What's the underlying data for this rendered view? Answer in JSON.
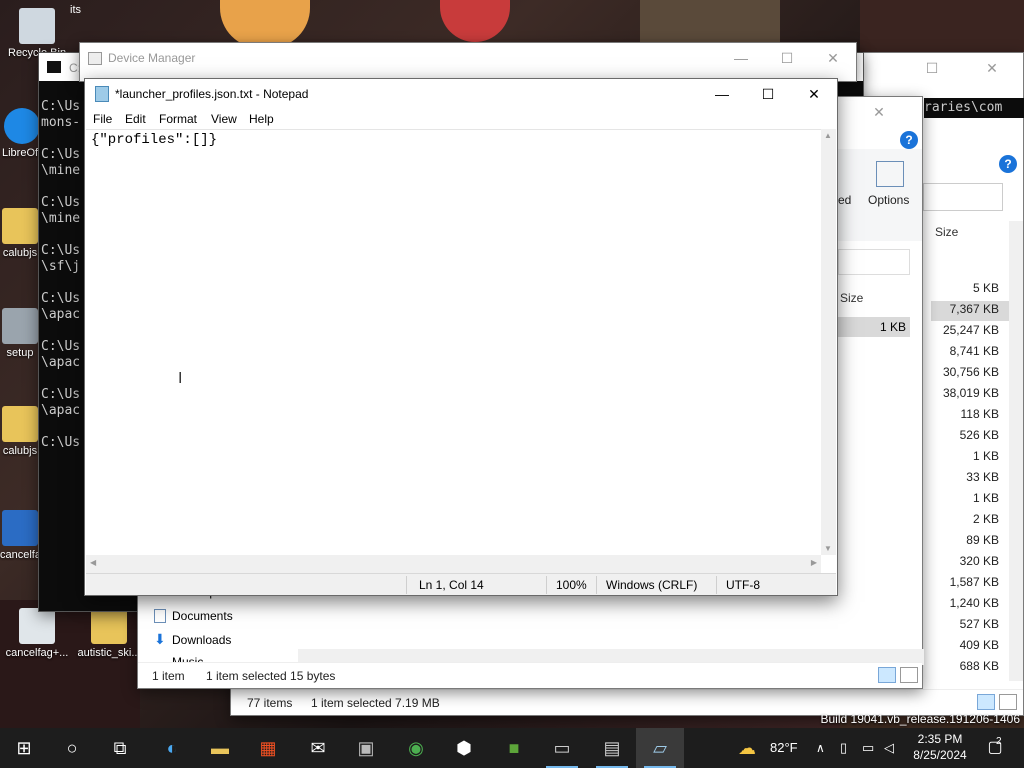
{
  "desktop": {
    "top_label": "its",
    "watermark": "Build 19041.vb_release.191206-1406",
    "icons": [
      {
        "label": "Recycle Bin"
      },
      {
        "label": "LibreOffice"
      },
      {
        "label": "calubjs"
      },
      {
        "label": "setup"
      },
      {
        "label": "calubjs"
      },
      {
        "label": "cancelfag..."
      },
      {
        "label": "cancelfag+..."
      },
      {
        "label": "autistic_ski..."
      }
    ]
  },
  "console": {
    "title": "C:",
    "lines": [
      "C:\\Us",
      "mons-",
      "",
      "C:\\Us",
      "\\mine",
      "",
      "C:\\Us",
      "\\mine",
      "",
      "C:\\Us",
      "\\sf\\j",
      "",
      "C:\\Us",
      "\\apac",
      "",
      "C:\\Us",
      "\\apac",
      "",
      "C:\\Us",
      "\\apac",
      "",
      "C:\\Us"
    ],
    "right_text": "raries\\com"
  },
  "device_manager": {
    "title": "Device Manager"
  },
  "explorer_a": {
    "ribbon_left_text": "ed",
    "options_label": "Options",
    "size_header": "Size",
    "row_size": "1 KB",
    "nav": [
      "Desktop",
      "Documents",
      "Downloads",
      "Music"
    ],
    "status_items": "1 item",
    "status_selected": "1 item selected  15 bytes"
  },
  "explorer_b": {
    "size_header": "Size",
    "sizes": [
      "5 KB",
      "7,367 KB",
      "25,247 KB",
      "8,741 KB",
      "30,756 KB",
      "38,019 KB",
      "118 KB",
      "526 KB",
      "1 KB",
      "33 KB",
      "1 KB",
      "2 KB",
      "89 KB",
      "320 KB",
      "1,587 KB",
      "1,240 KB",
      "527 KB",
      "409 KB",
      "688 KB"
    ],
    "status_items": "77 items",
    "status_selected": "1 item selected  7.19 MB"
  },
  "notepad": {
    "title": "*launcher_profiles.json.txt - Notepad",
    "menu": [
      "File",
      "Edit",
      "Format",
      "View",
      "Help"
    ],
    "content": "{\"profiles\":[]}",
    "status": {
      "position": "Ln 1, Col 14",
      "zoom": "100%",
      "line_endings": "Windows (CRLF)",
      "encoding": "UTF-8"
    }
  },
  "taskbar": {
    "weather_temp": "82°F",
    "time": "2:35 PM",
    "date": "8/25/2024",
    "notification_count": "2"
  },
  "colors": {
    "taskbar": "#1d1d1d",
    "accent": "#76b9ed",
    "selection": "#cce8ff"
  }
}
